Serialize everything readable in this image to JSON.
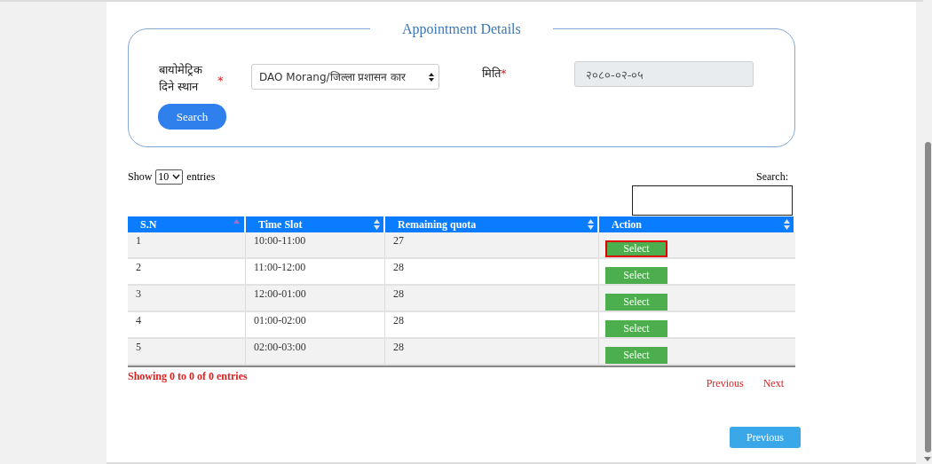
{
  "form": {
    "legend": "Appointment Details",
    "location_label": "बायोमेट्रिक दिने स्थान",
    "location_required": "*",
    "location_value": "DAO Morang/जिल्ला प्रशासन कार",
    "date_label": "मिति",
    "date_required": "*",
    "date_value": "२०८०-०२-०५",
    "search_button": "Search"
  },
  "table_controls": {
    "show_label": "Show",
    "page_size": "10",
    "entries_label": "entries",
    "search_label": "Search:"
  },
  "table": {
    "columns": [
      {
        "label": "S.N",
        "kind": "sorted"
      },
      {
        "label": "Time Slot",
        "kind": "sortable"
      },
      {
        "label": "Remaining quota",
        "kind": "sortable"
      },
      {
        "label": "Action",
        "kind": "sortable"
      }
    ],
    "rows": [
      {
        "sn": "1",
        "time_slot": "10:00-11:00",
        "quota": "27",
        "action": "Select",
        "selected": true
      },
      {
        "sn": "2",
        "time_slot": "11:00-12:00",
        "quota": "28",
        "action": "Select",
        "selected": false
      },
      {
        "sn": "3",
        "time_slot": "12:00-01:00",
        "quota": "28",
        "action": "Select",
        "selected": false
      },
      {
        "sn": "4",
        "time_slot": "01:00-02:00",
        "quota": "28",
        "action": "Select",
        "selected": false
      },
      {
        "sn": "5",
        "time_slot": "02:00-03:00",
        "quota": "28",
        "action": "Select",
        "selected": false
      }
    ]
  },
  "pagination": {
    "info": "Showing 0 to 0 of 0 entries",
    "previous": "Previous",
    "next": "Next"
  },
  "footer_button": "Previous"
}
